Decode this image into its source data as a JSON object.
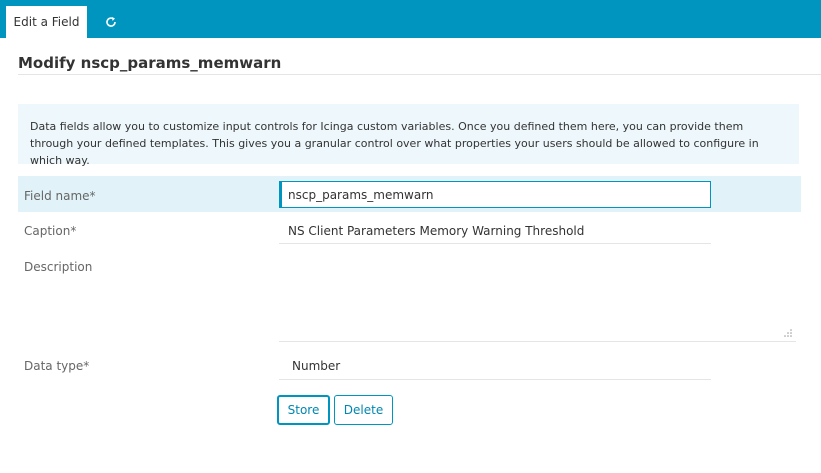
{
  "tabs": {
    "active_label": "Edit a Field",
    "refresh_icon": "refresh-icon"
  },
  "page": {
    "title": "Modify nscp_params_memwarn"
  },
  "hint": {
    "text": "Data fields allow you to customize input controls for Icinga custom variables. Once you defined them here, you can provide them through your defined templates. This gives you a granular control over what properties your users should be allowed to configure in which way."
  },
  "form": {
    "field_name": {
      "label": "Field name*",
      "value": "nscp_params_memwarn"
    },
    "caption": {
      "label": "Caption*",
      "value": "NS Client Parameters Memory Warning Threshold"
    },
    "description": {
      "label": "Description",
      "value": ""
    },
    "data_type": {
      "label": "Data type*",
      "value": "Number"
    }
  },
  "buttons": {
    "store": "Store",
    "delete": "Delete"
  },
  "colors": {
    "accent": "#0095bf",
    "hint_bg": "#eef7fb",
    "row_highlight": "#e1f3f8"
  }
}
